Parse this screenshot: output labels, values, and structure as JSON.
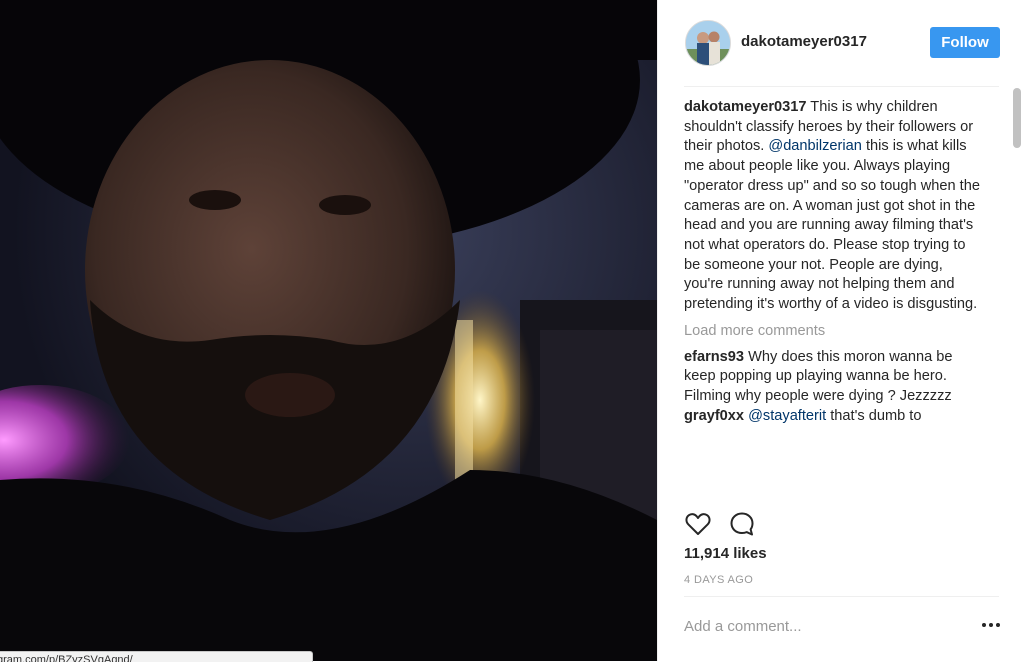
{
  "post": {
    "author": "dakotameyer0317",
    "follow_label": "Follow",
    "caption": {
      "user": "dakotameyer0317",
      "text_before": " This is why children shouldn't classify heroes by their followers or their photos. ",
      "mention": "@danbilzerian",
      "text_after": " this is what kills me about people like you. Always playing \"operator dress up\" and so so tough when the cameras are on. A woman just got shot in the head and you are running away filming that's not what operators do. Please stop trying to be someone your not. People are dying, you're running away not helping them and pretending it's worthy of a video is disgusting."
    },
    "load_more_label": "Load more comments",
    "comments": [
      {
        "user": "efarns93",
        "text": " Why does this moron wanna be keep popping up playing wanna be hero. Filming why people were dying ? Jezzzzz"
      },
      {
        "user": "grayf0xx",
        "mention": "@stayafterit",
        "text": " that's dumb to"
      }
    ],
    "likes": "11,914 likes",
    "timestamp": "4 DAYS AGO",
    "comment_placeholder": "Add a comment...",
    "more_icon": "ellipsis-icon"
  },
  "icons": {
    "like": "heart-icon",
    "comment": "speech-bubble-icon"
  },
  "statusbar": {
    "url": "gram.com/p/BZyzSVgAgnd/"
  },
  "colors": {
    "follow": "#3897f0",
    "mention": "#003569",
    "muted": "#999999",
    "text": "#262626"
  }
}
